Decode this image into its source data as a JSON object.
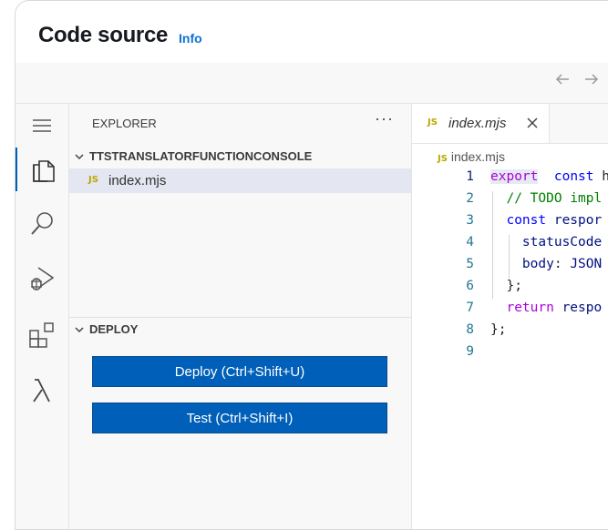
{
  "header": {
    "title": "Code source",
    "info_link": "Info"
  },
  "toolbar": {
    "back_icon": "arrow-left-icon",
    "forward_icon": "arrow-right-icon"
  },
  "activity_bar": {
    "items": [
      "menu-icon",
      "files-icon",
      "search-icon",
      "run-debug-icon",
      "extensions-icon",
      "lambda-icon"
    ]
  },
  "explorer": {
    "title": "EXPLORER",
    "more_label": "···",
    "folder": {
      "name": "TTSTRANSLATORFUNCTIONCONSOLE",
      "files": [
        {
          "badge": "JS",
          "name": "index.mjs"
        }
      ]
    },
    "deploy": {
      "title": "DEPLOY",
      "deploy_button": "Deploy (Ctrl+Shift+U)",
      "test_button": "Test (Ctrl+Shift+I)"
    }
  },
  "editor": {
    "tab": {
      "badge": "JS",
      "name": "index.mjs",
      "close": "×"
    },
    "breadcrumb": {
      "badge": "JS",
      "name": "index.mjs"
    },
    "lines": [
      {
        "num": "1",
        "tokens": [
          [
            "kw2",
            "export"
          ],
          [
            "",
            "  "
          ],
          [
            "kw",
            "const"
          ],
          [
            "",
            " h"
          ]
        ]
      },
      {
        "num": "2",
        "tokens": [
          [
            "cm",
            "  // TODO impl"
          ]
        ]
      },
      {
        "num": "3",
        "tokens": [
          [
            "kw",
            "  const"
          ],
          [
            "id",
            " respor"
          ]
        ]
      },
      {
        "num": "4",
        "tokens": [
          [
            "id",
            "    statusCode"
          ]
        ]
      },
      {
        "num": "5",
        "tokens": [
          [
            "id",
            "    body"
          ],
          [
            "",
            ": "
          ],
          [
            "id",
            "JSON"
          ]
        ]
      },
      {
        "num": "6",
        "tokens": [
          [
            "",
            "  };"
          ]
        ]
      },
      {
        "num": "7",
        "tokens": [
          [
            "kw2",
            "  return"
          ],
          [
            "id",
            " respo"
          ]
        ]
      },
      {
        "num": "8",
        "tokens": [
          [
            "",
            "};"
          ]
        ]
      },
      {
        "num": "9",
        "tokens": []
      }
    ]
  }
}
